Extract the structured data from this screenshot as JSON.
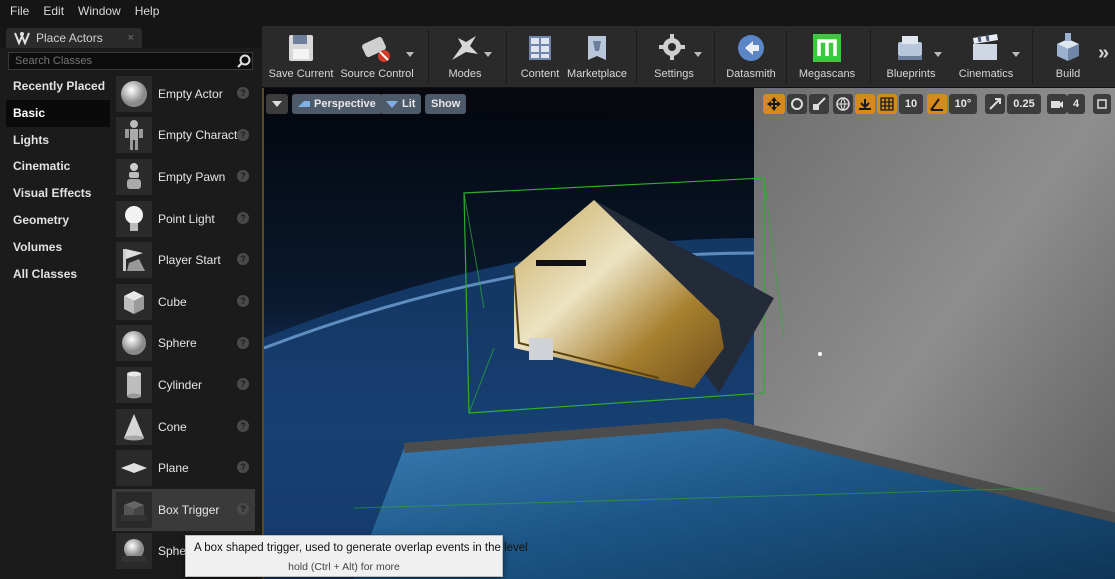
{
  "menu": [
    "File",
    "Edit",
    "Window",
    "Help"
  ],
  "panel_tab": {
    "label": "Place Actors",
    "close": "×"
  },
  "search": {
    "placeholder": "Search Classes"
  },
  "categories": [
    "Recently Placed",
    "Basic",
    "Lights",
    "Cinematic",
    "Visual Effects",
    "Geometry",
    "Volumes",
    "All Classes"
  ],
  "active_category": "Basic",
  "actors": [
    {
      "label": "Empty Actor",
      "icon": "sphere-white-icon"
    },
    {
      "label": "Empty Charact",
      "icon": "character-icon"
    },
    {
      "label": "Empty Pawn",
      "icon": "pawn-icon"
    },
    {
      "label": "Point Light",
      "icon": "light-bulb-icon"
    },
    {
      "label": "Player Start",
      "icon": "player-start-icon"
    },
    {
      "label": "Cube",
      "icon": "cube-icon"
    },
    {
      "label": "Sphere",
      "icon": "sphere-icon"
    },
    {
      "label": "Cylinder",
      "icon": "cylinder-icon"
    },
    {
      "label": "Cone",
      "icon": "cone-icon"
    },
    {
      "label": "Plane",
      "icon": "plane-icon"
    },
    {
      "label": "Box Trigger",
      "icon": "box-trigger-icon"
    },
    {
      "label": "Spher",
      "icon": "sphere-trigger-icon"
    }
  ],
  "selected_actor": "Box Trigger",
  "info_glyph": "?",
  "toolbar": [
    {
      "label": "Save Current",
      "icon": "save-icon",
      "dropdown": false
    },
    {
      "label": "Source Control",
      "icon": "source-control-icon",
      "dropdown": true
    },
    {
      "label": "Modes",
      "icon": "modes-icon",
      "dropdown": true
    },
    {
      "label": "Content",
      "icon": "content-icon",
      "dropdown": false
    },
    {
      "label": "Marketplace",
      "icon": "marketplace-icon",
      "dropdown": false
    },
    {
      "label": "Settings",
      "icon": "settings-icon",
      "dropdown": true
    },
    {
      "label": "Datasmith",
      "icon": "datasmith-icon",
      "dropdown": false
    },
    {
      "label": "Megascans",
      "icon": "megascans-icon",
      "dropdown": false
    },
    {
      "label": "Blueprints",
      "icon": "blueprints-icon",
      "dropdown": true
    },
    {
      "label": "Cinematics",
      "icon": "cinematics-icon",
      "dropdown": true
    },
    {
      "label": "Build",
      "icon": "build-icon",
      "dropdown": false
    }
  ],
  "more_glyph": "»",
  "viewport": {
    "perspective_label": "Perspective",
    "lit_label": "Lit",
    "show_label": "Show",
    "grid_snap": "10",
    "rotation_snap": "10°",
    "scale_snap": "0.25",
    "camera_speed": "4"
  },
  "tooltip": {
    "text": "A box shaped trigger, used to generate overlap events in the level",
    "hint": "hold (Ctrl + Alt) for more"
  },
  "colors": {
    "accent": "#d58a1c",
    "viewport_button": "#4d5a6a",
    "megascans": "#3ec63e"
  }
}
